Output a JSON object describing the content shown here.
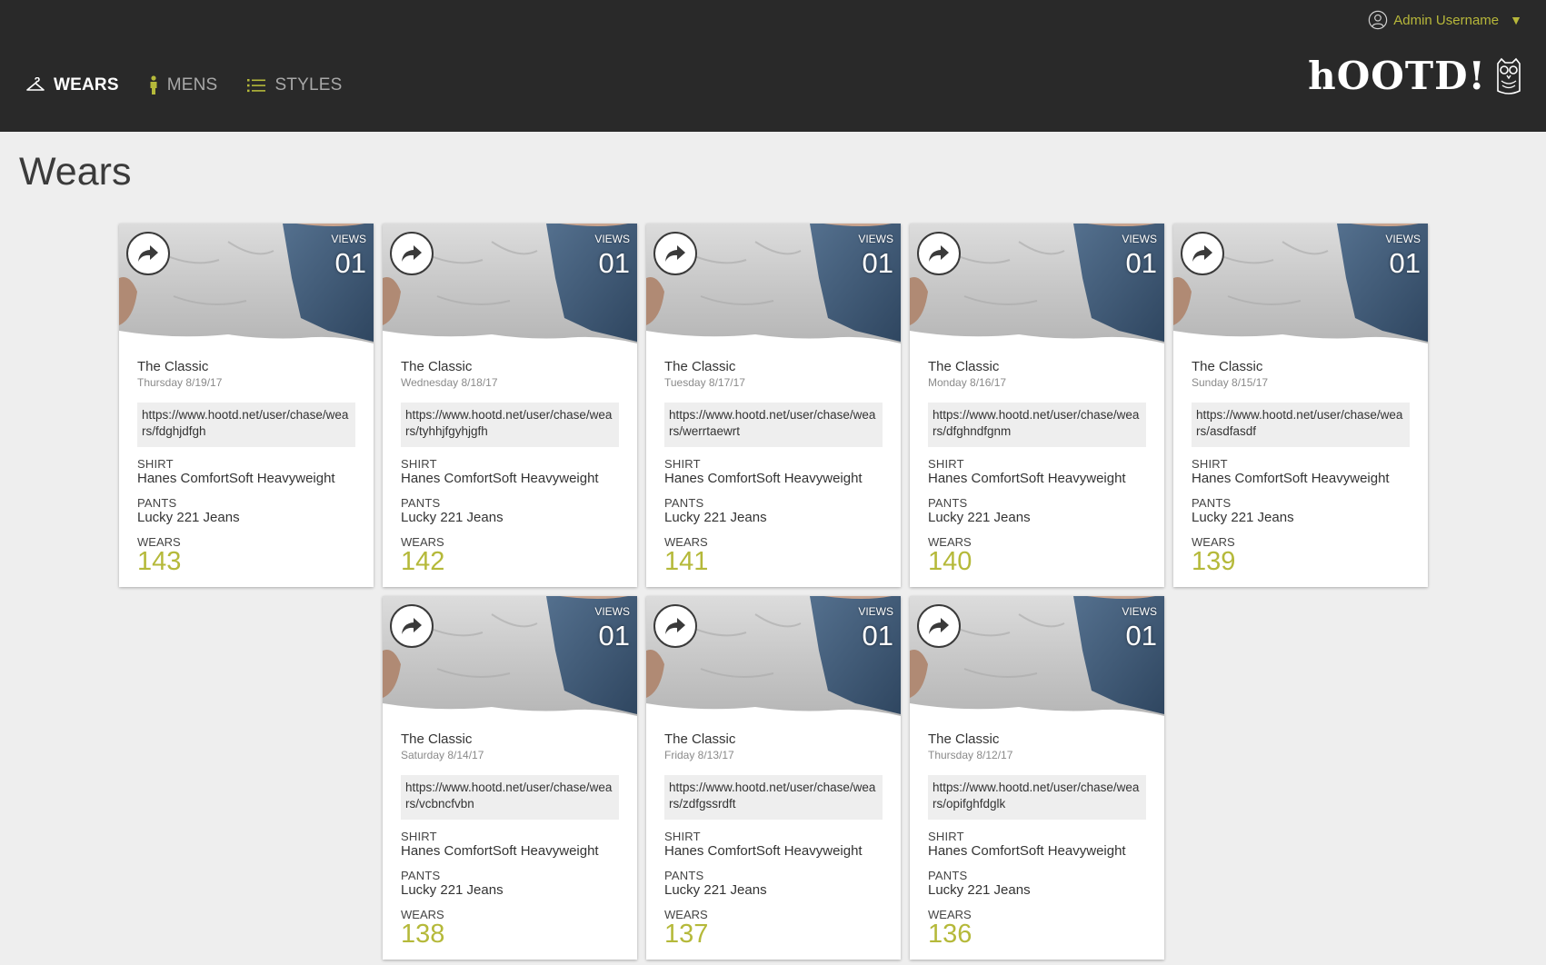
{
  "header": {
    "user_label": "Admin Username",
    "logo_text": "hOOTD!",
    "nav": [
      {
        "label": "WEARS",
        "icon": "hanger-icon",
        "active": true
      },
      {
        "label": "MENS",
        "icon": "person-icon",
        "active": false
      },
      {
        "label": "STYLES",
        "icon": "list-icon",
        "active": false
      }
    ]
  },
  "page": {
    "title": "Wears"
  },
  "colors": {
    "accent": "#b5b93a",
    "topbar": "#292929",
    "background": "#eeeeee"
  },
  "cards": [
    {
      "views_label": "VIEWS",
      "views": "01",
      "name": "The Classic",
      "date": "Thursday 8/19/17",
      "url": "https://www.hootd.net/user/chase/wears/fdghjdfgh",
      "shirt_label": "SHIRT",
      "shirt": "Hanes ComfortSoft Heavyweight",
      "pants_label": "PANTS",
      "pants": "Lucky 221 Jeans",
      "wears_label": "WEARS",
      "wears": "143"
    },
    {
      "views_label": "VIEWS",
      "views": "01",
      "name": "The Classic",
      "date": "Wednesday 8/18/17",
      "url": "https://www.hootd.net/user/chase/wears/tyhhjfgyhjgfh",
      "shirt_label": "SHIRT",
      "shirt": "Hanes ComfortSoft Heavyweight",
      "pants_label": "PANTS",
      "pants": "Lucky 221 Jeans",
      "wears_label": "WEARS",
      "wears": "142"
    },
    {
      "views_label": "VIEWS",
      "views": "01",
      "name": "The Classic",
      "date": "Tuesday 8/17/17",
      "url": "https://www.hootd.net/user/chase/wears/werrtaewrt",
      "shirt_label": "SHIRT",
      "shirt": "Hanes ComfortSoft Heavyweight",
      "pants_label": "PANTS",
      "pants": "Lucky 221 Jeans",
      "wears_label": "WEARS",
      "wears": "141"
    },
    {
      "views_label": "VIEWS",
      "views": "01",
      "name": "The Classic",
      "date": "Monday 8/16/17",
      "url": "https://www.hootd.net/user/chase/wears/dfghndfgnm",
      "shirt_label": "SHIRT",
      "shirt": "Hanes ComfortSoft Heavyweight",
      "pants_label": "PANTS",
      "pants": "Lucky 221 Jeans",
      "wears_label": "WEARS",
      "wears": "140"
    },
    {
      "views_label": "VIEWS",
      "views": "01",
      "name": "The Classic",
      "date": "Sunday 8/15/17",
      "url": "https://www.hootd.net/user/chase/wears/asdfasdf",
      "shirt_label": "SHIRT",
      "shirt": "Hanes ComfortSoft Heavyweight",
      "pants_label": "PANTS",
      "pants": "Lucky 221 Jeans",
      "wears_label": "WEARS",
      "wears": "139"
    },
    {
      "views_label": "VIEWS",
      "views": "01",
      "name": "The Classic",
      "date": "Saturday 8/14/17",
      "url": "https://www.hootd.net/user/chase/wears/vcbncfvbn",
      "shirt_label": "SHIRT",
      "shirt": "Hanes ComfortSoft Heavyweight",
      "pants_label": "PANTS",
      "pants": "Lucky 221 Jeans",
      "wears_label": "WEARS",
      "wears": "138"
    },
    {
      "views_label": "VIEWS",
      "views": "01",
      "name": "The Classic",
      "date": "Friday 8/13/17",
      "url": "https://www.hootd.net/user/chase/wears/zdfgssrdft",
      "shirt_label": "SHIRT",
      "shirt": "Hanes ComfortSoft Heavyweight",
      "pants_label": "PANTS",
      "pants": "Lucky 221 Jeans",
      "wears_label": "WEARS",
      "wears": "137"
    },
    {
      "views_label": "VIEWS",
      "views": "01",
      "name": "The Classic",
      "date": "Thursday 8/12/17",
      "url": "https://www.hootd.net/user/chase/wears/opifghfdglk",
      "shirt_label": "SHIRT",
      "shirt": "Hanes ComfortSoft Heavyweight",
      "pants_label": "PANTS",
      "pants": "Lucky 221 Jeans",
      "wears_label": "WEARS",
      "wears": "136"
    }
  ]
}
